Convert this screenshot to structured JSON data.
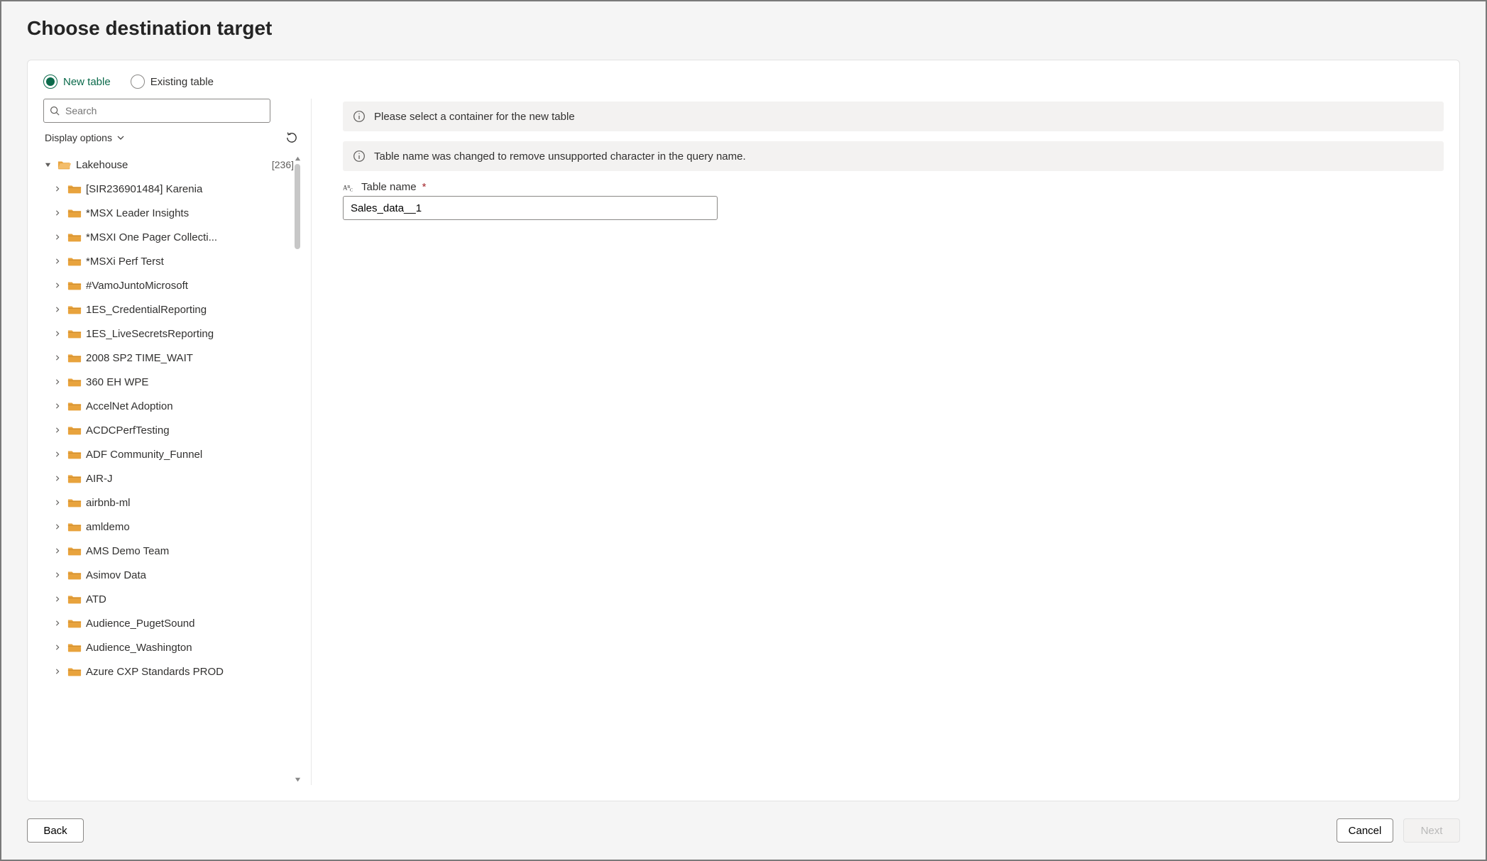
{
  "header": {
    "title": "Choose destination target"
  },
  "tabs": {
    "new_table": "New table",
    "existing_table": "Existing table"
  },
  "sidebar": {
    "search_placeholder": "Search",
    "display_options": "Display options",
    "root": {
      "label": "Lakehouse",
      "count": "[236]"
    },
    "items": [
      {
        "label": "[SIR236901484] Karenia"
      },
      {
        "label": "*MSX Leader Insights"
      },
      {
        "label": "*MSXI One Pager Collecti..."
      },
      {
        "label": "*MSXi Perf Terst"
      },
      {
        "label": "#VamoJuntoMicrosoft"
      },
      {
        "label": "1ES_CredentialReporting"
      },
      {
        "label": "1ES_LiveSecretsReporting"
      },
      {
        "label": "2008 SP2 TIME_WAIT"
      },
      {
        "label": "360 EH WPE"
      },
      {
        "label": "AccelNet Adoption"
      },
      {
        "label": "ACDCPerfTesting"
      },
      {
        "label": "ADF Community_Funnel"
      },
      {
        "label": "AIR-J"
      },
      {
        "label": "airbnb-ml"
      },
      {
        "label": "amldemo"
      },
      {
        "label": "AMS Demo Team"
      },
      {
        "label": "Asimov Data"
      },
      {
        "label": "ATD"
      },
      {
        "label": "Audience_PugetSound"
      },
      {
        "label": "Audience_Washington"
      },
      {
        "label": "Azure CXP Standards PROD"
      }
    ]
  },
  "main": {
    "info1": "Please select a container for the new table",
    "info2": "Table name was changed to remove unsupported character in the query name.",
    "table_name_label": "Table name",
    "table_name_value": "Sales_data__1"
  },
  "footer": {
    "back": "Back",
    "cancel": "Cancel",
    "next": "Next"
  }
}
